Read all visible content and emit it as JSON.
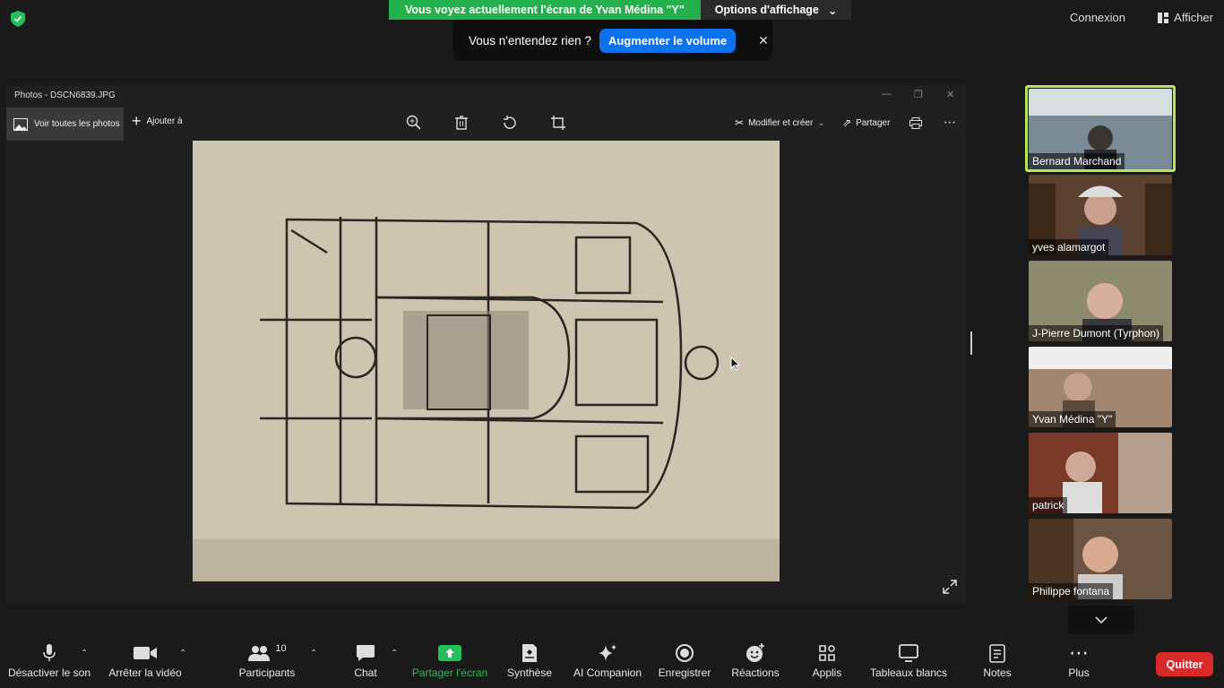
{
  "banner": {
    "sharing_text": "Vous voyez actuellement l'écran de Yvan Médina  \"Y\"",
    "options_label": "Options d'affichage"
  },
  "toast": {
    "message": "Vous n'entendez rien ?",
    "button": "Augmenter le volume"
  },
  "top_right": {
    "connexion": "Connexion",
    "afficher": "Afficher"
  },
  "photos_app": {
    "title": "Photos - DSCN6839.JPG",
    "voir": "Voir toutes les photos",
    "ajouter": "Ajouter à",
    "modifier": "Modifier et créer",
    "partager": "Partager"
  },
  "participants": [
    {
      "name": "Bernard Marchand",
      "bg": "#7a8a95"
    },
    {
      "name": "yves alamargot",
      "bg": "#5a4030"
    },
    {
      "name": "J-Pierre Dumont (Tyrphon)",
      "bg": "#8e8a70"
    },
    {
      "name": "Yvan Médina  \"Y\"",
      "bg": "#a08570"
    },
    {
      "name": "patrick",
      "bg": "#7a3a2a"
    },
    {
      "name": "Philippe fontana",
      "bg": "#6a5545"
    }
  ],
  "toolbar": {
    "mute": "Désactiver le son",
    "video": "Arrêter la vidéo",
    "participants": "Participants",
    "participants_count": "10",
    "chat": "Chat",
    "share": "Partager l'écran",
    "synthese": "Synthèse",
    "ai": "AI Companion",
    "record": "Enregistrer",
    "reactions": "Réactions",
    "apps": "Applis",
    "whiteboards": "Tableaux blancs",
    "notes": "Notes",
    "more": "Plus",
    "quit": "Quitter"
  },
  "colors": {
    "accent_green": "#22b14c",
    "accent_blue": "#0e72ed",
    "quit_red": "#d92a2a",
    "active_speaker": "#b8e65a"
  }
}
